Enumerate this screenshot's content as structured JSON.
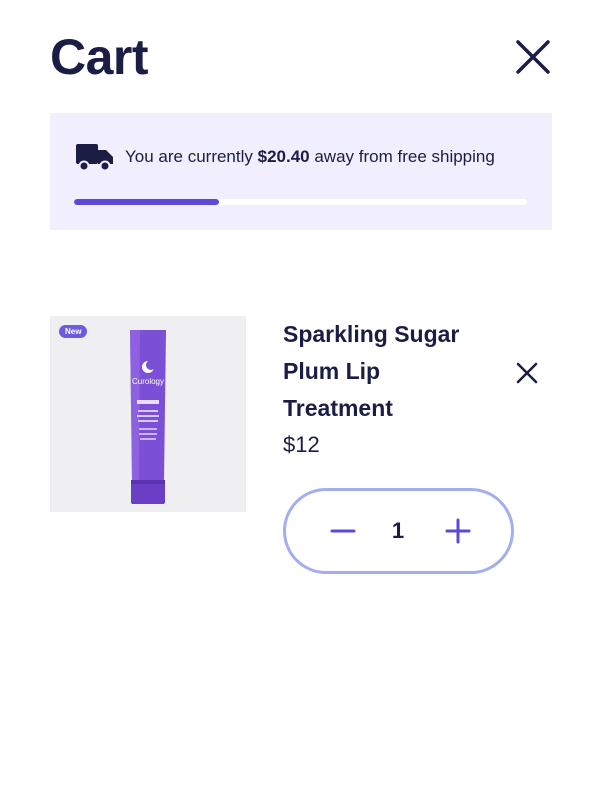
{
  "header": {
    "title": "Cart"
  },
  "shipping": {
    "prefix": "You are currently ",
    "amount": "$20.40",
    "suffix": " away from free shipping",
    "progress_fraction": 0.32,
    "progress_color": "#5b4ad6"
  },
  "item": {
    "badge": "New",
    "name": "Sparkling Sugar Plum Lip Treatment",
    "price": "$12",
    "quantity": "1",
    "image_brand_text": "Curology"
  },
  "colors": {
    "text": "#1b1d45",
    "panel_bg": "#f1eefd",
    "stepper_border": "#a3aef0",
    "accent": "#5b4ad6"
  },
  "icons": {
    "close": "close-icon",
    "truck": "truck-icon",
    "remove": "close-icon",
    "minus": "minus-icon",
    "plus": "plus-icon"
  }
}
